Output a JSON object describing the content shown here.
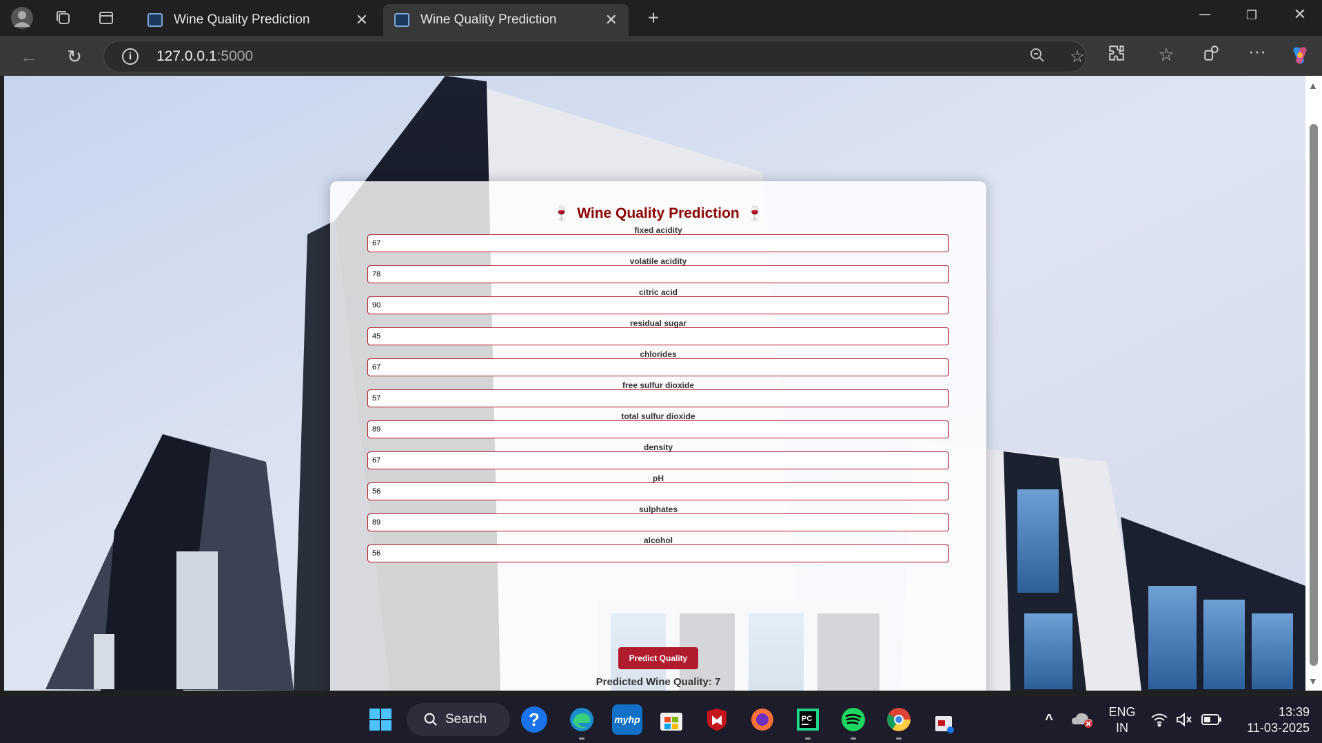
{
  "browser": {
    "tabs": [
      {
        "label": "Wine Quality Prediction",
        "active": false
      },
      {
        "label": "Wine Quality Prediction",
        "active": true
      }
    ],
    "address": {
      "host": "127.0.0.1",
      "port": ":5000"
    }
  },
  "page": {
    "title": "Wine Quality Prediction",
    "title_icon": "🍷",
    "fields": [
      {
        "label": "fixed acidity",
        "value": "67"
      },
      {
        "label": "volatile acidity",
        "value": "78"
      },
      {
        "label": "citric acid",
        "value": "90"
      },
      {
        "label": "residual sugar",
        "value": "45"
      },
      {
        "label": "chlorides",
        "value": "67"
      },
      {
        "label": "free sulfur dioxide",
        "value": "57"
      },
      {
        "label": "total sulfur dioxide",
        "value": "89"
      },
      {
        "label": "density",
        "value": "67"
      },
      {
        "label": "pH",
        "value": "56"
      },
      {
        "label": "sulphates",
        "value": "89"
      },
      {
        "label": "alcohol",
        "value": "56"
      }
    ],
    "button_label": "Predict Quality",
    "result_text": "Predicted Wine Quality: 7"
  },
  "taskbar": {
    "search_label": "Search",
    "lang_line1": "ENG",
    "lang_line2": "IN",
    "time": "13:39",
    "date": "11-03-2025"
  },
  "colors": {
    "accent": "#b01c2e",
    "title": "#8b0000",
    "input_border": "#b01020"
  }
}
